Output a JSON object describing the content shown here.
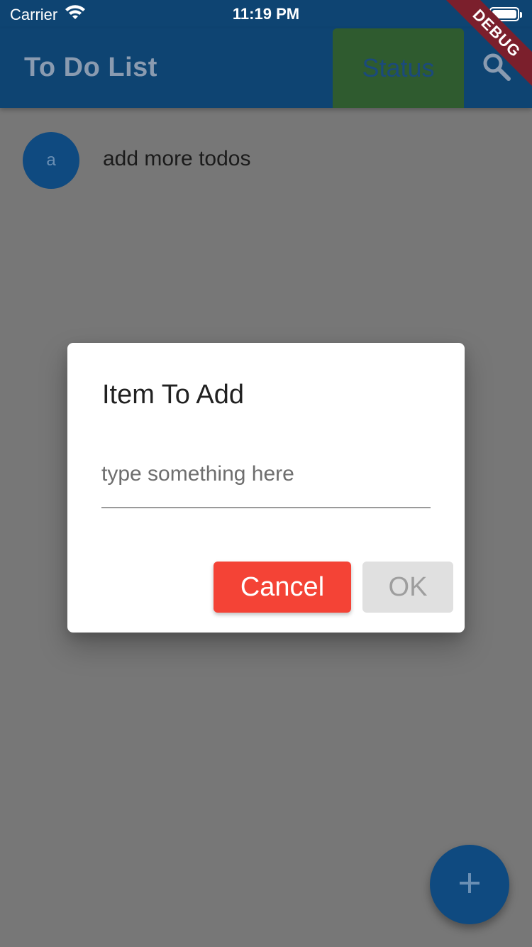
{
  "status_bar": {
    "carrier": "Carrier",
    "time": "11:19 PM"
  },
  "app_bar": {
    "title": "To Do List",
    "status_button_label": "Status"
  },
  "debug_banner": "DEBUG",
  "list": {
    "items": [
      {
        "avatar_letter": "a",
        "text": "add more todos"
      }
    ]
  },
  "dialog": {
    "title": "Item To Add",
    "input_placeholder": "type something here",
    "input_value": "",
    "cancel_label": "Cancel",
    "ok_label": "OK"
  },
  "fab": {
    "icon": "plus-icon"
  },
  "colors": {
    "app_bar": "#0e4472",
    "cancel": "#f44336",
    "ok_disabled": "#e0e0e0",
    "fab": "#0f4a80",
    "status_button": "#2f5b2f"
  }
}
